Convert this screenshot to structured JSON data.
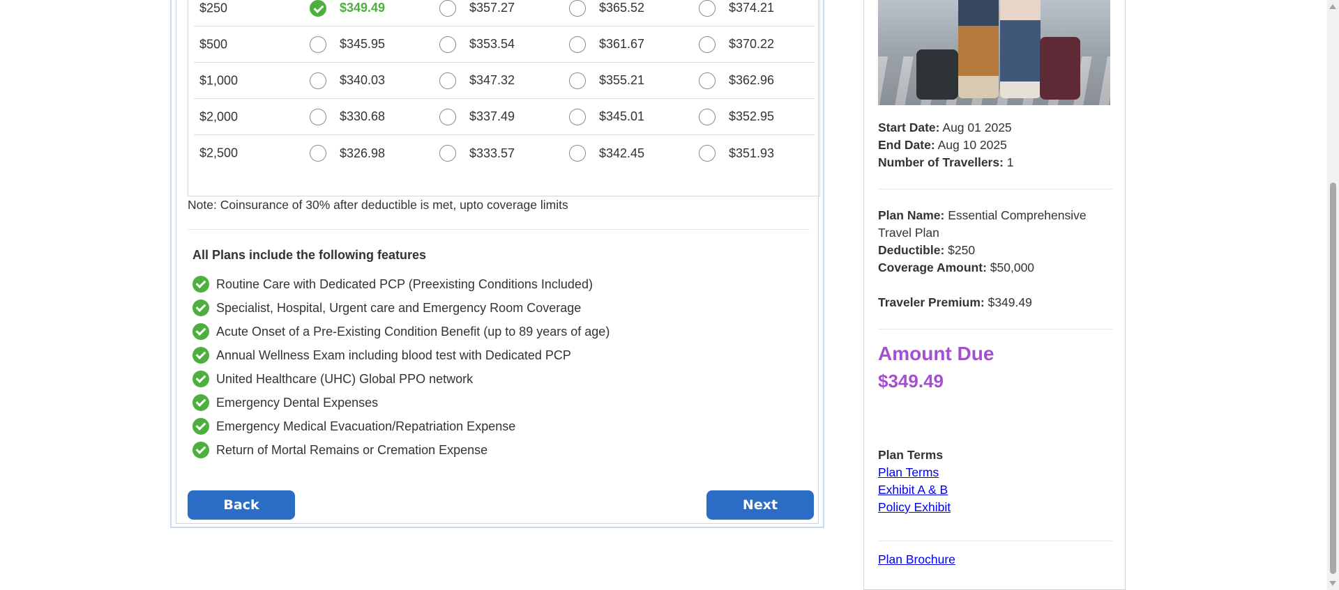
{
  "rates_table": {
    "rows": [
      {
        "deductible": "$250",
        "prices": [
          "$349.49",
          "$357.27",
          "$365.52",
          "$374.21"
        ],
        "selected_index": 0
      },
      {
        "deductible": "$500",
        "prices": [
          "$345.95",
          "$353.54",
          "$361.67",
          "$370.22"
        ],
        "selected_index": -1
      },
      {
        "deductible": "$1,000",
        "prices": [
          "$340.03",
          "$347.32",
          "$355.21",
          "$362.96"
        ],
        "selected_index": -1
      },
      {
        "deductible": "$2,000",
        "prices": [
          "$330.68",
          "$337.49",
          "$345.01",
          "$352.95"
        ],
        "selected_index": -1
      },
      {
        "deductible": "$2,500",
        "prices": [
          "$326.98",
          "$333.57",
          "$342.45",
          "$351.93"
        ],
        "selected_index": -1
      }
    ],
    "selected_color": "#4caf3e"
  },
  "note": "Note: Coinsurance of 30% after deductible is met, upto coverage limits",
  "features": {
    "title": "All Plans include the following features",
    "items": [
      "Routine Care with Dedicated PCP (Preexisting Conditions Included)",
      "Specialist, Hospital, Urgent care and Emergency Room Coverage",
      "Acute Onset of a Pre-Existing Condition Benefit (up to 89 years of age)",
      "Annual Wellness Exam including blood test with Dedicated PCP",
      "United Healthcare (UHC) Global PPO network",
      "Emergency Dental Expenses",
      "Emergency Medical Evacuation/Repatriation Expense",
      "Return of Mortal Remains or Cremation Expense"
    ]
  },
  "buttons": {
    "back": "Back",
    "next": "Next",
    "color": "#2b6cc4"
  },
  "summary": {
    "start_date_label": "Start Date:",
    "start_date": "Aug 01 2025",
    "end_date_label": "End Date:",
    "end_date": "Aug 10 2025",
    "travellers_label": "Number of Travellers:",
    "travellers": "1",
    "plan_name_label": "Plan Name:",
    "plan_name": "Essential Comprehensive Travel Plan",
    "deductible_label": "Deductible:",
    "deductible": "$250",
    "coverage_label": "Coverage Amount:",
    "coverage": "$50,000",
    "premium_label": "Traveler Premium:",
    "premium": "$349.49",
    "amount_due_label": "Amount Due",
    "amount_due": "$349.49",
    "amount_color": "#a44fcf",
    "plan_terms_heading": "Plan Terms",
    "links": [
      "Plan Terms",
      "Exhibit A & B",
      "Policy Exhibit"
    ],
    "brochure_link": "Plan Brochure"
  }
}
